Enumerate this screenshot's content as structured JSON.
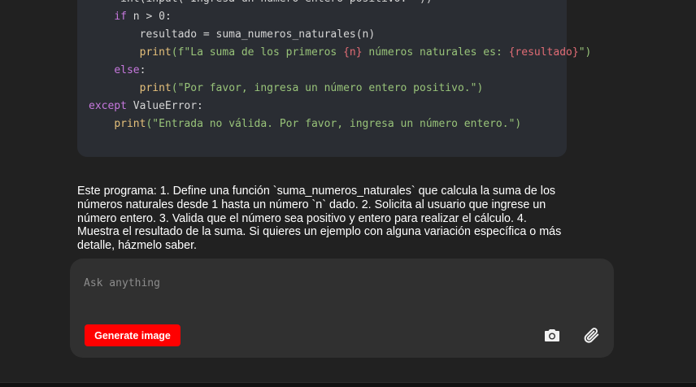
{
  "code": {
    "partial_top_line": "   = int(input(\"Ingresa un número entero positivo: \"))",
    "lines": [
      [
        {
          "t": "    "
        },
        {
          "t": "if",
          "c": "kw"
        },
        {
          "t": " n > "
        },
        {
          "t": "0",
          "c": "num"
        },
        {
          "t": ":"
        }
      ],
      [
        {
          "t": "        resultado = suma_numeros_naturales(n)"
        }
      ],
      [
        {
          "t": "        "
        },
        {
          "t": "print",
          "c": "fn"
        },
        {
          "t": "(f\"La suma de los primeros ",
          "c": "str"
        },
        {
          "t": "{n}",
          "c": "interp"
        },
        {
          "t": " números naturales es: ",
          "c": "str"
        },
        {
          "t": "{resultado}",
          "c": "interp"
        },
        {
          "t": "\")",
          "c": "str"
        }
      ],
      [
        {
          "t": "    "
        },
        {
          "t": "else",
          "c": "kw"
        },
        {
          "t": ":"
        }
      ],
      [
        {
          "t": "        "
        },
        {
          "t": "print",
          "c": "fn"
        },
        {
          "t": "(\"Por favor, ingresa un número entero positivo.\")",
          "c": "str"
        }
      ],
      [
        {
          "t": ""
        },
        {
          "t": "except",
          "c": "kw"
        },
        {
          "t": " ValueError:"
        }
      ],
      [
        {
          "t": "    "
        },
        {
          "t": "print",
          "c": "fn"
        },
        {
          "t": "(\"Entrada no válida. Por favor, ingresa un número entero.\")",
          "c": "str"
        }
      ]
    ]
  },
  "answer_text": "Este programa: 1. Define una función `suma_numeros_naturales` que calcula la suma de los números naturales desde 1 hasta un número `n` dado. 2. Solicita al usuario que ingrese un número entero. 3. Valida que el número sea positivo y entero para realizar el cálculo. 4. Muestra el resultado de la suma. Si quieres un ejemplo con alguna variación específica o más detalle, házmelo saber.",
  "composer": {
    "placeholder": "Ask anything",
    "value": "",
    "generate_label": "Generate image"
  },
  "icons": {
    "camera": "camera-icon",
    "attach": "paperclip-icon"
  },
  "colors": {
    "background": "#212121",
    "code_bg": "#2a2d33",
    "composer_bg": "#303030",
    "accent": "#ff0000"
  }
}
